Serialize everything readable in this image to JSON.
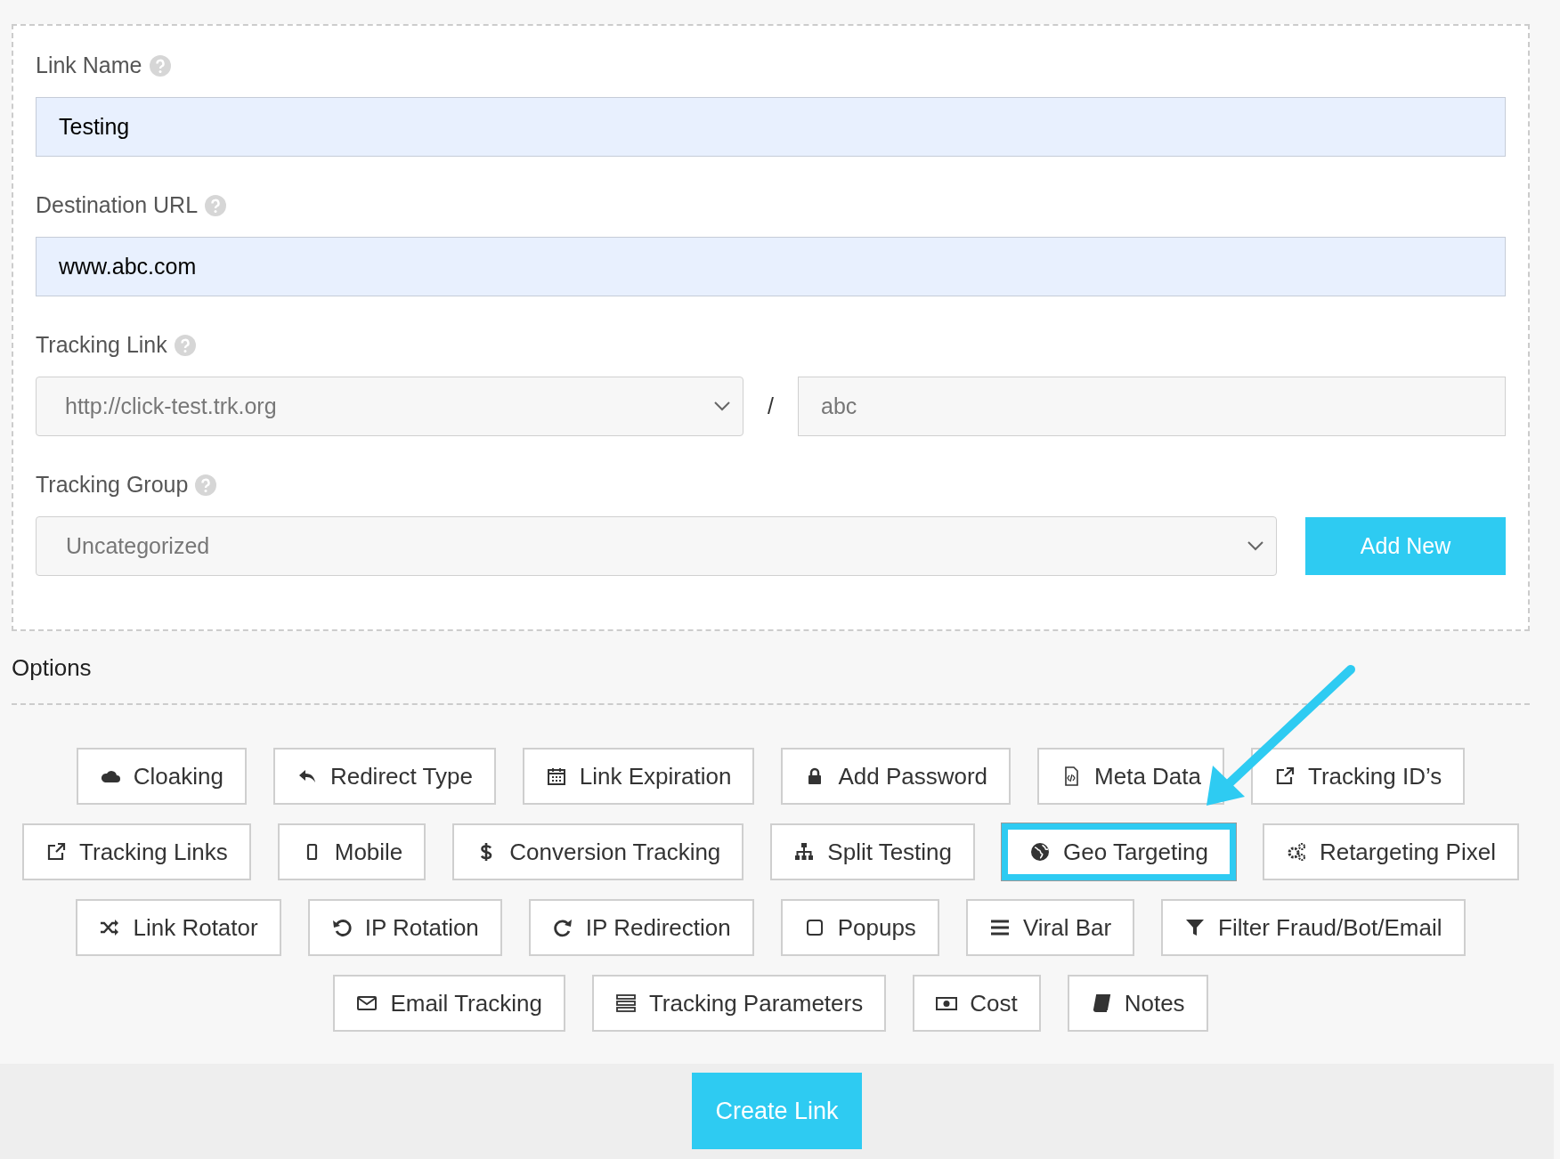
{
  "form": {
    "fields": [
      {
        "kind": "text",
        "label": "Link Name",
        "value": "Testing"
      },
      {
        "kind": "text",
        "label": "Destination URL",
        "value": "www.abc.com"
      },
      {
        "kind": "split",
        "label": "Tracking Link",
        "value": "http://click-test.trk.org",
        "separator": "/",
        "second_value": "abc"
      },
      {
        "kind": "select_add",
        "label": "Tracking Group",
        "value": "Uncategorized",
        "button": "Add New"
      }
    ]
  },
  "options": {
    "title": "Options",
    "buttons": [
      {
        "label": "Cloaking",
        "highlighted": false
      },
      {
        "label": "Redirect Type",
        "highlighted": false
      },
      {
        "label": "Link Expiration",
        "highlighted": false
      },
      {
        "label": "Add Password",
        "highlighted": false
      },
      {
        "label": "Meta Data",
        "highlighted": false
      },
      {
        "label": "Tracking ID’s",
        "highlighted": false
      },
      {
        "label": "Tracking Links",
        "highlighted": false
      },
      {
        "label": "Mobile",
        "highlighted": false
      },
      {
        "label": "Conversion Tracking",
        "highlighted": false
      },
      {
        "label": "Split Testing",
        "highlighted": false
      },
      {
        "label": "Geo Targeting",
        "highlighted": true
      },
      {
        "label": "Retargeting Pixel",
        "highlighted": false
      },
      {
        "label": "Link Rotator",
        "highlighted": false
      },
      {
        "label": "IP Rotation",
        "highlighted": false
      },
      {
        "label": "IP Redirection",
        "highlighted": false
      },
      {
        "label": "Popups",
        "highlighted": false
      },
      {
        "label": "Viral Bar",
        "highlighted": false
      },
      {
        "label": "Filter Fraud/Bot/Email",
        "highlighted": false
      },
      {
        "label": "Email Tracking",
        "highlighted": false
      },
      {
        "label": "Tracking Parameters",
        "highlighted": false
      },
      {
        "label": "Cost",
        "highlighted": false
      },
      {
        "label": "Notes",
        "highlighted": false
      }
    ]
  },
  "footer": {
    "button": "Create Link"
  }
}
